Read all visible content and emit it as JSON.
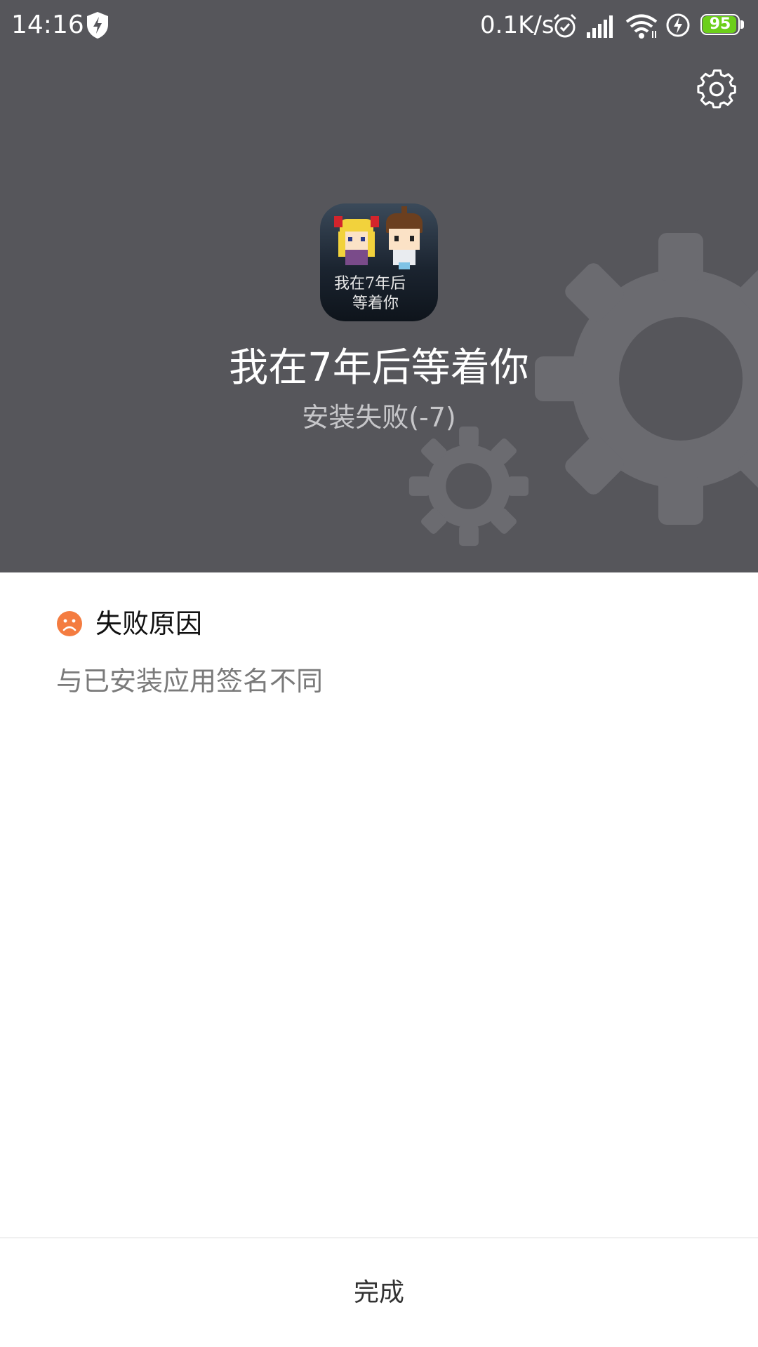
{
  "status_bar": {
    "time": "14:16",
    "network_speed": "0.1K/s",
    "battery_level": "95",
    "battery_fraction": 0.95,
    "icons": [
      "shield-bolt-icon",
      "alarm-icon",
      "signal-icon",
      "wifi-icon",
      "charging-icon",
      "battery-icon"
    ]
  },
  "header": {
    "settings_icon": "gear-icon",
    "app_icon_line1": "我在7年后",
    "app_icon_line2": "等着你",
    "app_name": "我在7年后等着你",
    "install_status": "安装失败(-7)"
  },
  "reason": {
    "icon": "sad-face-icon",
    "title": "失败原因",
    "text": "与已安装应用签名不同"
  },
  "footer": {
    "done_label": "完成"
  },
  "colors": {
    "header_bg": "#56565b",
    "accent_orange": "#f47c40",
    "battery_green": "#6ccf1a"
  }
}
